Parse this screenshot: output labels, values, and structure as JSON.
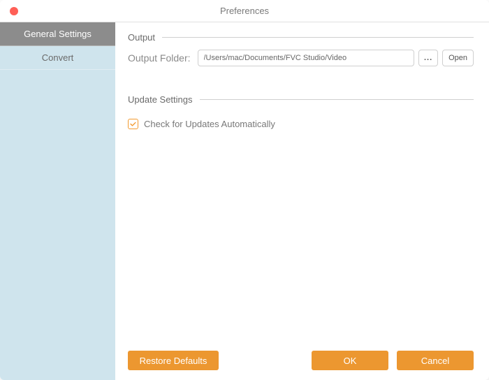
{
  "title": "Preferences",
  "sidebar": {
    "items": [
      {
        "label": "General Settings",
        "active": true
      },
      {
        "label": "Convert",
        "active": false
      }
    ]
  },
  "sections": {
    "output": {
      "heading": "Output",
      "folder_label": "Output Folder:",
      "folder_path": "/Users/mac/Documents/FVC Studio/Video",
      "browse_label": "...",
      "open_label": "Open"
    },
    "update": {
      "heading": "Update Settings",
      "check_label": "Check for Updates Automatically",
      "checked": true
    }
  },
  "footer": {
    "restore": "Restore Defaults",
    "ok": "OK",
    "cancel": "Cancel"
  }
}
